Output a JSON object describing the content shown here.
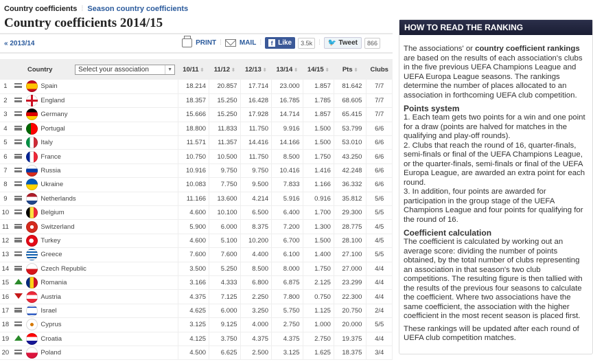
{
  "subnav": {
    "current": "Country coefficients",
    "link": "Season country coefficients"
  },
  "page_title": "Country coefficients 2014/15",
  "toolbar": {
    "prev_label": "« 2013/14",
    "print_label": "PRINT",
    "mail_label": "MAIL",
    "like_label": "Like",
    "like_count": "3.5k",
    "tweet_label": "Tweet",
    "tweet_count": "866"
  },
  "table": {
    "headers": {
      "country": "Country",
      "select_placeholder": "Select your association",
      "cols": [
        "10/11",
        "11/12",
        "12/13",
        "13/14",
        "14/15",
        "Pts",
        "Clubs"
      ]
    },
    "rows": [
      {
        "rank": "1",
        "move": "same",
        "country": "Spain",
        "flag": "spain",
        "v": [
          "18.214",
          "20.857",
          "17.714",
          "23.000",
          "1.857"
        ],
        "pts": "81.642",
        "clubs": "7/7"
      },
      {
        "rank": "2",
        "move": "same",
        "country": "England",
        "flag": "england",
        "v": [
          "18.357",
          "15.250",
          "16.428",
          "16.785",
          "1.785"
        ],
        "pts": "68.605",
        "clubs": "7/7"
      },
      {
        "rank": "3",
        "move": "same",
        "country": "Germany",
        "flag": "germany",
        "v": [
          "15.666",
          "15.250",
          "17.928",
          "14.714",
          "1.857"
        ],
        "pts": "65.415",
        "clubs": "7/7"
      },
      {
        "rank": "4",
        "move": "same",
        "country": "Portugal",
        "flag": "portugal",
        "v": [
          "18.800",
          "11.833",
          "11.750",
          "9.916",
          "1.500"
        ],
        "pts": "53.799",
        "clubs": "6/6"
      },
      {
        "rank": "5",
        "move": "same",
        "country": "Italy",
        "flag": "italy",
        "v": [
          "11.571",
          "11.357",
          "14.416",
          "14.166",
          "1.500"
        ],
        "pts": "53.010",
        "clubs": "6/6"
      },
      {
        "rank": "6",
        "move": "same",
        "country": "France",
        "flag": "france",
        "v": [
          "10.750",
          "10.500",
          "11.750",
          "8.500",
          "1.750"
        ],
        "pts": "43.250",
        "clubs": "6/6"
      },
      {
        "rank": "7",
        "move": "same",
        "country": "Russia",
        "flag": "russia",
        "v": [
          "10.916",
          "9.750",
          "9.750",
          "10.416",
          "1.416"
        ],
        "pts": "42.248",
        "clubs": "6/6"
      },
      {
        "rank": "8",
        "move": "same",
        "country": "Ukraine",
        "flag": "ukraine",
        "v": [
          "10.083",
          "7.750",
          "9.500",
          "7.833",
          "1.166"
        ],
        "pts": "36.332",
        "clubs": "6/6"
      },
      {
        "rank": "9",
        "move": "same",
        "country": "Netherlands",
        "flag": "netherlands",
        "v": [
          "11.166",
          "13.600",
          "4.214",
          "5.916",
          "0.916"
        ],
        "pts": "35.812",
        "clubs": "5/6"
      },
      {
        "rank": "10",
        "move": "same",
        "country": "Belgium",
        "flag": "belgium",
        "v": [
          "4.600",
          "10.100",
          "6.500",
          "6.400",
          "1.700"
        ],
        "pts": "29.300",
        "clubs": "5/5"
      },
      {
        "rank": "11",
        "move": "same",
        "country": "Switzerland",
        "flag": "switzerland",
        "v": [
          "5.900",
          "6.000",
          "8.375",
          "7.200",
          "1.300"
        ],
        "pts": "28.775",
        "clubs": "4/5"
      },
      {
        "rank": "12",
        "move": "same",
        "country": "Turkey",
        "flag": "turkey",
        "v": [
          "4.600",
          "5.100",
          "10.200",
          "6.700",
          "1.500"
        ],
        "pts": "28.100",
        "clubs": "4/5"
      },
      {
        "rank": "13",
        "move": "same",
        "country": "Greece",
        "flag": "greece",
        "v": [
          "7.600",
          "7.600",
          "4.400",
          "6.100",
          "1.400"
        ],
        "pts": "27.100",
        "clubs": "5/5"
      },
      {
        "rank": "14",
        "move": "same",
        "country": "Czech Republic",
        "flag": "czech",
        "v": [
          "3.500",
          "5.250",
          "8.500",
          "8.000",
          "1.750"
        ],
        "pts": "27.000",
        "clubs": "4/4"
      },
      {
        "rank": "15",
        "move": "up",
        "country": "Romania",
        "flag": "romania",
        "v": [
          "3.166",
          "4.333",
          "6.800",
          "6.875",
          "2.125"
        ],
        "pts": "23.299",
        "clubs": "4/4"
      },
      {
        "rank": "16",
        "move": "down",
        "country": "Austria",
        "flag": "austria",
        "v": [
          "4.375",
          "7.125",
          "2.250",
          "7.800",
          "0.750"
        ],
        "pts": "22.300",
        "clubs": "4/4"
      },
      {
        "rank": "17",
        "move": "same",
        "country": "Israel",
        "flag": "israel",
        "v": [
          "4.625",
          "6.000",
          "3.250",
          "5.750",
          "1.125"
        ],
        "pts": "20.750",
        "clubs": "2/4"
      },
      {
        "rank": "18",
        "move": "same",
        "country": "Cyprus",
        "flag": "cyprus",
        "v": [
          "3.125",
          "9.125",
          "4.000",
          "2.750",
          "1.000"
        ],
        "pts": "20.000",
        "clubs": "5/5"
      },
      {
        "rank": "19",
        "move": "up",
        "country": "Croatia",
        "flag": "croatia",
        "v": [
          "4.125",
          "3.750",
          "4.375",
          "4.375",
          "2.750"
        ],
        "pts": "19.375",
        "clubs": "4/4"
      },
      {
        "rank": "20",
        "move": "same",
        "country": "Poland",
        "flag": "poland",
        "v": [
          "4.500",
          "6.625",
          "2.500",
          "3.125",
          "1.625"
        ],
        "pts": "18.375",
        "clubs": "3/4"
      }
    ]
  },
  "sidebar": {
    "title": "HOW TO READ THE RANKING",
    "intro_pre": "The associations' or ",
    "intro_bold": "country coefficient rankings",
    "intro_post": " are based on the results of each association's clubs in the five previous UEFA Champions League and UEFA Europa League seasons. The rankings determine the number of places allocated to an association in forthcoming UEFA club competition.",
    "points_heading": "Points system",
    "points_1": "1. Each team gets two points for a win and one point for a draw (points are halved for matches in the qualifying and play-off rounds).",
    "points_2": "2. Clubs that reach the round of 16, quarter-finals, semi-finals or final of the UEFA Champions League, or the quarter-finals, semi-finals or final of the UEFA Europa League, are awarded an extra point for each round.",
    "points_3": "3. In addition, four points are awarded for participation in the group stage of the UEFA Champions League and four points for qualifying for the round of 16.",
    "coef_heading": "Coefficient calculation",
    "coef_text": "The coefficient is calculated by working out an average score: dividing the number of points obtained, by the total number of clubs representing an association in that season's two club competitions. The resulting figure is then tallied with the results of the previous four seasons to calculate the coefficient. Where two associations have the same coefficient, the association with the higher coefficient in the most recent season is placed first.",
    "footer": "These rankings will be updated after each round of UEFA club competition matches."
  }
}
